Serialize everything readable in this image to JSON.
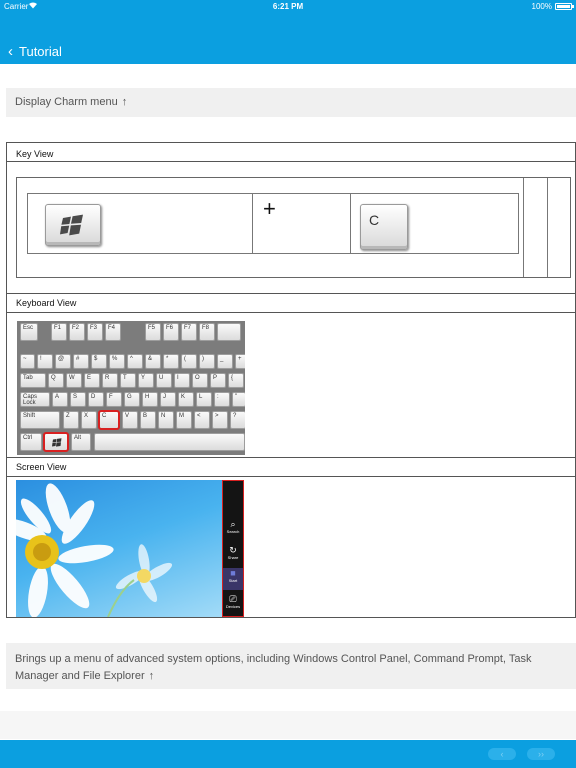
{
  "status_bar": {
    "carrier": "Carrier",
    "time": "6:21 PM",
    "battery": "100%"
  },
  "nav": {
    "back_glyph": "‹",
    "title": "Tutorial"
  },
  "heading": {
    "text": "Display Charm menu",
    "arrow": "↑"
  },
  "table": {
    "key_view_label": "Key View",
    "keys": [
      {
        "type": "key",
        "icon": "windows-logo-icon"
      },
      {
        "type": "operator",
        "text": "+"
      },
      {
        "type": "key",
        "text": "C"
      }
    ],
    "keyboard_view_label": "Keyboard View",
    "keyboard_highlights": [
      "C",
      "Win"
    ],
    "screen_view_label": "Screen View",
    "charms": [
      {
        "label": "Search",
        "icon": "search-icon"
      },
      {
        "label": "Share",
        "icon": "share-icon"
      },
      {
        "label": "Start",
        "icon": "windows-logo-icon"
      },
      {
        "label": "Devices",
        "icon": "devices-icon"
      }
    ]
  },
  "description": {
    "text": "Brings up a menu of advanced system options, including Windows Control Panel, Command Prompt, Task Manager and File Explorer",
    "arrow": "↑"
  },
  "footer": {
    "prev": "‹",
    "next": "››"
  },
  "colors": {
    "accent": "#0b9fe0",
    "highlight": "#d82020",
    "panel": "#f0f0f0"
  }
}
